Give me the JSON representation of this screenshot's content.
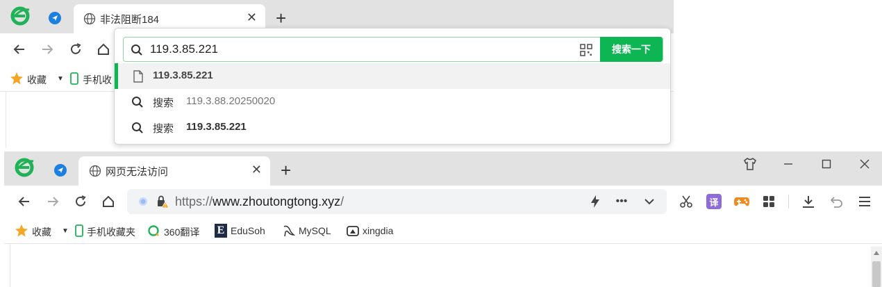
{
  "top_window": {
    "tab": {
      "title": "非法阻断184"
    },
    "dropdown": {
      "query": "119.3.85.221",
      "search_button": "搜索一下",
      "suggestions": [
        {
          "kind": "page",
          "text": "119.3.85.221"
        },
        {
          "kind": "search",
          "prefix": "搜索",
          "text": "119.3.88.20250020"
        },
        {
          "kind": "search",
          "prefix": "搜索",
          "text": "119.3.85.221"
        }
      ]
    },
    "bookmarks": {
      "favorites": "收藏",
      "mobile_fragment": "手机收"
    }
  },
  "bottom_window": {
    "tab": {
      "title": "网页无法访问"
    },
    "address": {
      "scheme": "https://",
      "host": "www.zhoutongtong.xyz",
      "path": "/"
    },
    "toolbar": {
      "translate_label": "译"
    },
    "bookmarks": {
      "favorites": "收藏",
      "items": [
        "手机收藏夹",
        "360翻译",
        "EduSoh",
        "MySQL",
        "xingdia"
      ]
    }
  },
  "colors": {
    "accent_green": "#0db653",
    "orange": "#f08a1c",
    "purple": "#8e6bd8",
    "blue": "#1d7fe0"
  }
}
